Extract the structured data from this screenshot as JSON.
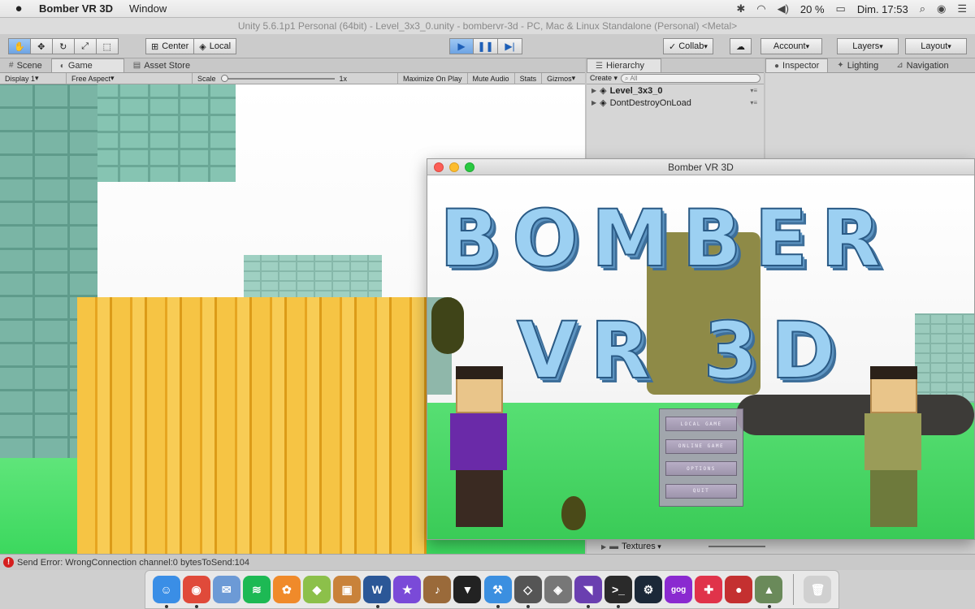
{
  "menubar": {
    "app_name": "Bomber VR 3D",
    "menus": [
      "Window"
    ],
    "battery": "20 %",
    "clock": "Dim. 17:53"
  },
  "unity": {
    "title": "Unity 5.6.1p1 Personal (64bit) - Level_3x3_0.unity - bombervr-3d - PC, Mac & Linux Standalone (Personal) <Metal>",
    "pivot": "Center",
    "space": "Local",
    "collab": "Collab",
    "account": "Account",
    "layers": "Layers",
    "layout": "Layout"
  },
  "tabs": {
    "scene": "Scene",
    "game": "Game",
    "asset_store": "Asset Store",
    "hierarchy": "Hierarchy",
    "inspector": "Inspector",
    "lighting": "Lighting",
    "navigation": "Navigation"
  },
  "game_bar": {
    "display": "Display 1",
    "aspect": "Free Aspect",
    "scale_label": "Scale",
    "scale_value": "1x",
    "maximize": "Maximize On Play",
    "mute": "Mute Audio",
    "stats": "Stats",
    "gizmos": "Gizmos"
  },
  "hierarchy": {
    "create": "Create",
    "search_placeholder": "All",
    "items": [
      "Level_3x3_0",
      "DontDestroyOnLoad"
    ]
  },
  "project": {
    "folder": "Textures"
  },
  "game_window": {
    "title": "Bomber VR 3D",
    "logo_line1": "BOMBER",
    "logo_line2": "VR 3D",
    "menu_buttons": [
      "LOCAL GAME",
      "ONLINE GAME",
      "OPTIONS",
      "QUIT"
    ]
  },
  "console": {
    "message": "Send Error: WrongConnection channel:0 bytesToSend:104"
  },
  "dock": {
    "apps": [
      {
        "icon": "finder-icon",
        "glyph": "☺",
        "color": "#3a8ee6",
        "running": true
      },
      {
        "icon": "chrome-icon",
        "glyph": "◉",
        "color": "#e04a3a",
        "running": true
      },
      {
        "icon": "mail-icon",
        "glyph": "✉",
        "color": "#6c9ad6",
        "running": false
      },
      {
        "icon": "spotify-icon",
        "glyph": "≋",
        "color": "#1db954",
        "running": false
      },
      {
        "icon": "photos-icon",
        "glyph": "✿",
        "color": "#f08a2a",
        "running": false
      },
      {
        "icon": "android-icon",
        "glyph": "◆",
        "color": "#8cc04a",
        "running": false
      },
      {
        "icon": "preview-icon",
        "glyph": "▣",
        "color": "#c9823a",
        "running": false
      },
      {
        "icon": "word-icon",
        "glyph": "W",
        "color": "#2b5797",
        "running": true
      },
      {
        "icon": "imovie-icon",
        "glyph": "★",
        "color": "#7a4ad8",
        "running": false
      },
      {
        "icon": "guitar-icon",
        "glyph": "♪",
        "color": "#9a6a3a",
        "running": false
      },
      {
        "icon": "guitar-pro-icon",
        "glyph": "▼",
        "color": "#222222",
        "running": false
      },
      {
        "icon": "xcode-icon",
        "glyph": "⚒",
        "color": "#3b8fe0",
        "running": true
      },
      {
        "icon": "unity-icon",
        "glyph": "◇",
        "color": "#555555",
        "running": true
      },
      {
        "icon": "unity-hub-icon",
        "glyph": "◈",
        "color": "#777777",
        "running": false
      },
      {
        "icon": "visual-studio-icon",
        "glyph": "◥",
        "color": "#6a3fb0",
        "running": true
      },
      {
        "icon": "terminal-icon",
        "glyph": ">_",
        "color": "#2a2a2a",
        "running": true
      },
      {
        "icon": "steam-icon",
        "glyph": "⚙",
        "color": "#1b2838",
        "running": false
      },
      {
        "icon": "gog-icon",
        "glyph": "gog",
        "color": "#8a2ad0",
        "running": false
      },
      {
        "icon": "games-icon",
        "glyph": "✚",
        "color": "#e0334a",
        "running": false
      },
      {
        "icon": "joystick-icon",
        "glyph": "●",
        "color": "#c43030",
        "running": false
      },
      {
        "icon": "bomber-vr-icon",
        "glyph": "▲",
        "color": "#6a8a5a",
        "running": true
      },
      {
        "icon": "trash-icon",
        "glyph": "🗑",
        "color": "#d0d0d0",
        "running": false
      }
    ]
  }
}
